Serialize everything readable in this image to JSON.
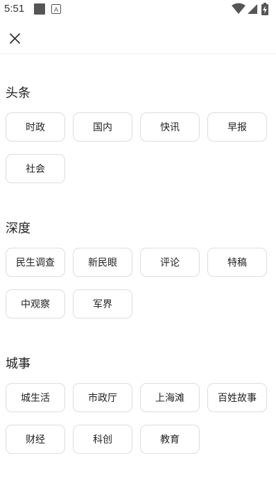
{
  "status_bar": {
    "time": "5:51",
    "app_icon_letter": "A",
    "icons": [
      "notification-square-icon",
      "a-notification-icon",
      "wifi-icon",
      "signal-icon",
      "battery-charging-icon"
    ]
  },
  "toolbar": {
    "close_icon": "close-icon"
  },
  "sections": [
    {
      "title": "头条",
      "items": [
        "时政",
        "国内",
        "快讯",
        "早报",
        "社会"
      ]
    },
    {
      "title": "深度",
      "items": [
        "民生调查",
        "新民眼",
        "评论",
        "特稿",
        "中观察",
        "军界"
      ]
    },
    {
      "title": "城事",
      "items": [
        "城生活",
        "市政厅",
        "上海滩",
        "百姓故事",
        "财经",
        "科创",
        "教育"
      ]
    }
  ],
  "colors": {
    "chip_border": "#dddddd",
    "divider": "#eeeeee",
    "text": "#222222",
    "background": "#ffffff"
  }
}
